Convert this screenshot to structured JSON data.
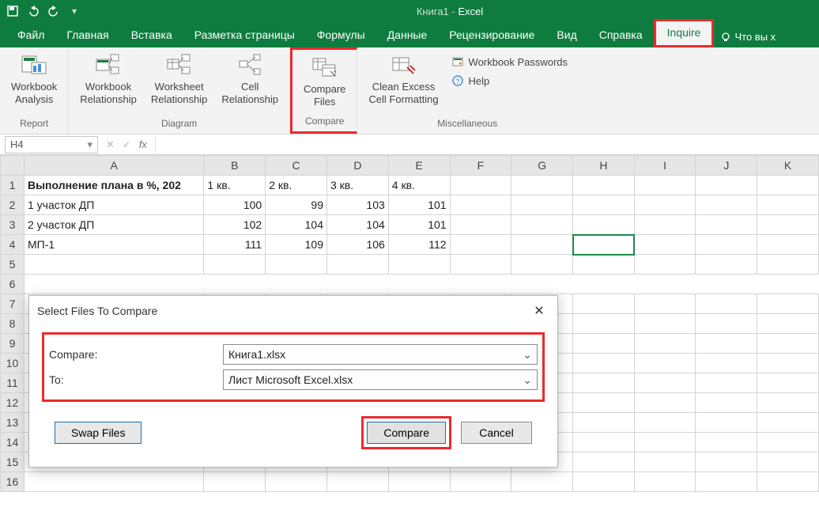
{
  "titlebar": {
    "workbook": "Книга1",
    "sep": " - ",
    "app": "Excel"
  },
  "tabs": {
    "file": "Файл",
    "items": [
      "Главная",
      "Вставка",
      "Разметка страницы",
      "Формулы",
      "Данные",
      "Рецензирование",
      "Вид",
      "Справка",
      "Inquire"
    ],
    "tellme": "Что вы х"
  },
  "ribbon": {
    "report": {
      "analysis": "Workbook\nAnalysis",
      "group": "Report"
    },
    "diagram": {
      "wb": "Workbook\nRelationship",
      "ws": "Worksheet\nRelationship",
      "cell": "Cell\nRelationship",
      "group": "Diagram"
    },
    "compare": {
      "btn": "Compare\nFiles",
      "group": "Compare"
    },
    "misc": {
      "clean": "Clean Excess\nCell Formatting",
      "pw": "Workbook Passwords",
      "help": "Help",
      "group": "Miscellaneous"
    }
  },
  "fbar": {
    "nameref": "H4",
    "fxlabel": "fx"
  },
  "cols": [
    "A",
    "B",
    "C",
    "D",
    "E",
    "F",
    "G",
    "H",
    "I",
    "J",
    "K"
  ],
  "sheet": {
    "r1": {
      "a": "Выполнение плана в %, 202",
      "b": "1 кв.",
      "c": "2 кв.",
      "d": "3 кв.",
      "e": "4 кв."
    },
    "r2": {
      "a": "1 участок ДП",
      "b": "100",
      "c": "99",
      "d": "103",
      "e": "101"
    },
    "r3": {
      "a": "2 участок ДП",
      "b": "102",
      "c": "104",
      "d": "104",
      "e": "101"
    },
    "r4": {
      "a": "МП-1",
      "b": "111",
      "c": "109",
      "d": "106",
      "e": "112"
    },
    "r5": {
      "a": ""
    }
  },
  "dialog": {
    "title": "Select Files To Compare",
    "compare_lbl": "Compare:",
    "to_lbl": "To:",
    "file1": "Книга1.xlsx",
    "file2": "Лист Microsoft Excel.xlsx",
    "swap": "Swap Files",
    "compare_btn": "Compare",
    "cancel": "Cancel"
  }
}
